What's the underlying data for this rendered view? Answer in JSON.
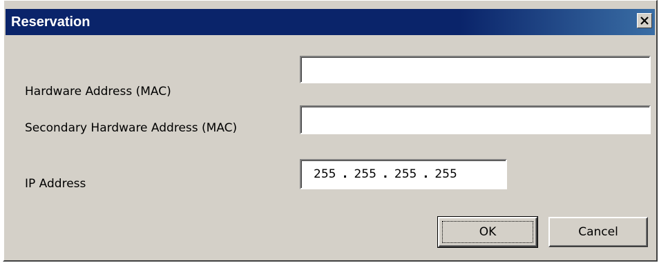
{
  "window": {
    "title": "Reservation",
    "close_icon": "close-icon"
  },
  "form": {
    "mac_label": "Hardware Address (MAC)",
    "mac_value": "",
    "secondary_mac_label": "Secondary Hardware Address (MAC)",
    "secondary_mac_value": "",
    "ip_label": "IP Address",
    "ip_octets": [
      "255",
      "255",
      "255",
      "255"
    ]
  },
  "buttons": {
    "ok_label": "OK",
    "cancel_label": "Cancel"
  },
  "colors": {
    "titlebar": "#0a246a",
    "dialog_bg": "#d4d0c8"
  }
}
